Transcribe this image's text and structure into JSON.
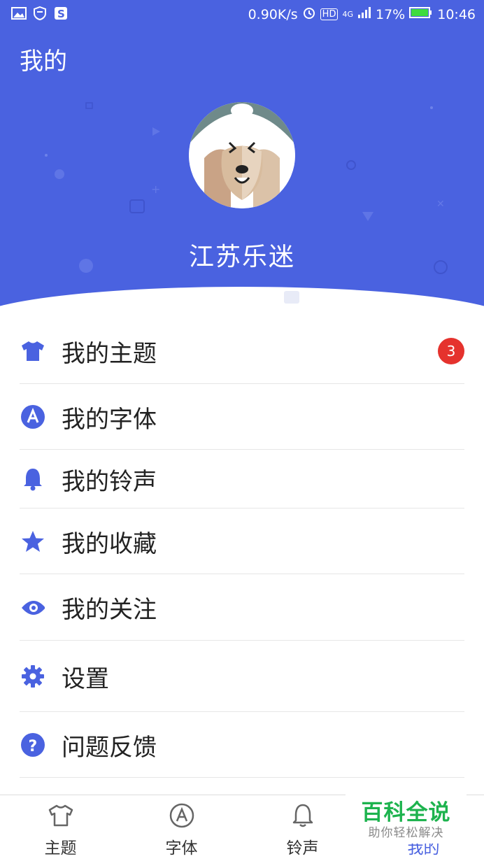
{
  "status_bar": {
    "network_speed": "0.90K/s",
    "network_type": "4G",
    "hd_label": "HD",
    "battery": "17%",
    "time": "10:46",
    "left_icons": [
      "image-icon",
      "shield-icon",
      "s-app-icon"
    ]
  },
  "header": {
    "title": "我的",
    "username": "江苏乐迷",
    "background_color": "#4a62e0"
  },
  "menu": {
    "items": [
      {
        "label": "我的主题",
        "icon": "tshirt-icon",
        "badge": "3"
      },
      {
        "label": "我的字体",
        "icon": "font-a-icon"
      },
      {
        "label": "我的铃声",
        "icon": "bell-icon"
      },
      {
        "label": "我的收藏",
        "icon": "star-icon"
      },
      {
        "label": "我的关注",
        "icon": "eye-icon"
      },
      {
        "label": "设置",
        "icon": "gear-icon"
      },
      {
        "label": "问题反馈",
        "icon": "question-icon"
      }
    ]
  },
  "tabbar": {
    "tabs": [
      {
        "label": "主题",
        "icon": "tshirt-outline-icon"
      },
      {
        "label": "字体",
        "icon": "font-a-outline-icon"
      },
      {
        "label": "铃声",
        "icon": "bell-outline-icon"
      },
      {
        "label": "我的",
        "icon": "person-icon",
        "active": true
      }
    ]
  },
  "watermark": {
    "title": "百科全说",
    "subtitle": "助你轻松解决"
  },
  "colors": {
    "accent": "#4a62e0",
    "badge": "#e5322d",
    "watermark_green": "#1db34e"
  }
}
